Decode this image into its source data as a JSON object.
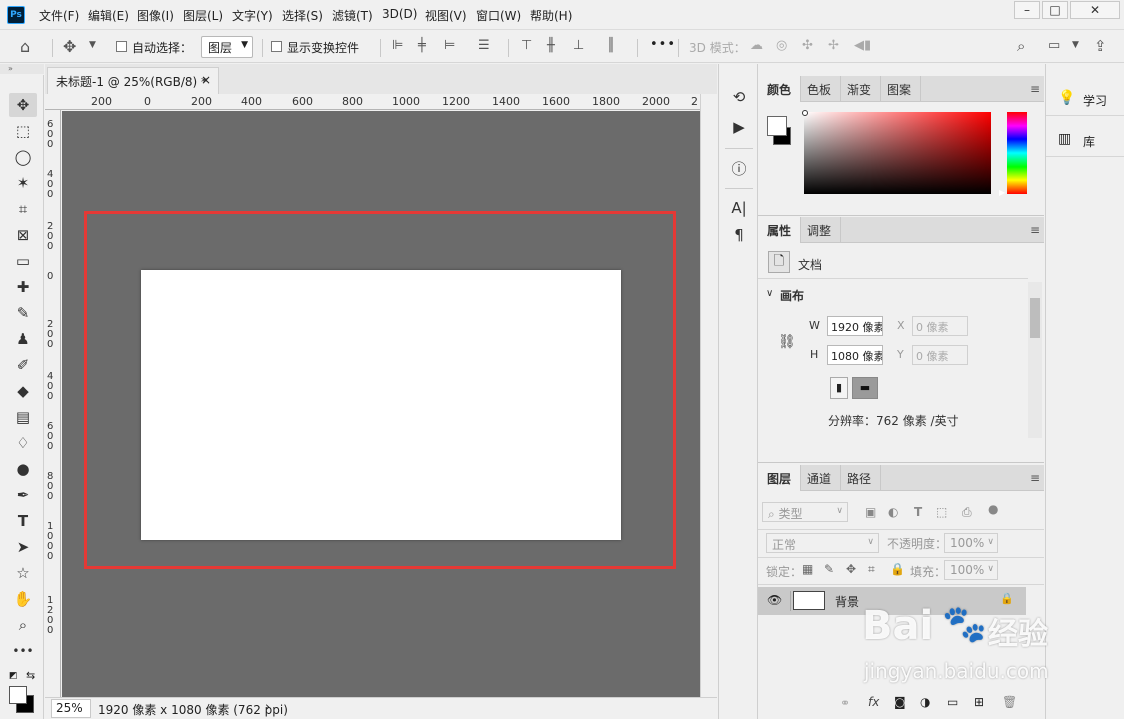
{
  "app": {
    "logo": "Ps"
  },
  "menubar": {
    "items": [
      "文件(F)",
      "编辑(E)",
      "图像(I)",
      "图层(L)",
      "文字(Y)",
      "选择(S)",
      "滤镜(T)",
      "3D(D)",
      "视图(V)",
      "窗口(W)",
      "帮助(H)"
    ],
    "window_controls": [
      "minimize-icon",
      "maximize-icon",
      "close-icon"
    ]
  },
  "options": {
    "auto_select_label": "自动选择：",
    "auto_select_target": "图层",
    "show_transform_label": "显示变换控件",
    "mode_3d_label": "3D 模式：",
    "more": "•••"
  },
  "document": {
    "tab_title": "未标题-1 @ 25%(RGB/8) *",
    "tab_close": "×",
    "ruler_h": [
      "200",
      "0",
      "200",
      "400",
      "600",
      "800",
      "1000",
      "1200",
      "1400",
      "1600",
      "1800",
      "2000",
      "2"
    ],
    "ruler_v": [
      "6 0 0",
      "4 0 0",
      "2 0 0",
      "0",
      "2 0 0",
      "4 0 0",
      "6 0 0",
      "8 0 0",
      "1 0 0 0",
      "1 2 0 0"
    ],
    "zoom": "25%",
    "status": "1920 像素 x 1080 像素 (762 ppi)",
    "status_arrow": "›"
  },
  "color_panel": {
    "tabs": [
      "颜色",
      "色板",
      "渐变",
      "图案"
    ],
    "active": "颜色"
  },
  "properties_panel": {
    "tabs": [
      "属性",
      "调整"
    ],
    "doc_label": "文档",
    "section": "画布",
    "w_label": "W",
    "w_value": "1920 像素",
    "h_label": "H",
    "h_value": "1080 像素",
    "x_label": "X",
    "x_value": "0 像素",
    "y_label": "Y",
    "y_value": "0 像素",
    "resolution": "分辨率：762 像素 /英寸"
  },
  "layers_panel": {
    "tabs": [
      "图层",
      "通道",
      "路径"
    ],
    "filter_kind": "类型",
    "blend_mode": "正常",
    "opacity_label": "不透明度：",
    "opacity_value": "100%",
    "lock_label": "锁定：",
    "fill_label": "填充：",
    "fill_value": "100%",
    "layers": [
      {
        "name": "背景",
        "visible": true,
        "locked": true
      }
    ],
    "footer_icons": [
      "link-icon",
      "fx-icon",
      "mask-icon",
      "adjustment-icon",
      "folder-icon",
      "new-layer-icon",
      "trash-icon"
    ],
    "footer_fx": "fx"
  },
  "right_dock": {
    "items": [
      "学习",
      "库"
    ]
  },
  "watermark": {
    "brand": "Bai",
    "brand2": "经验",
    "url": "jingyan.baidu.com"
  }
}
